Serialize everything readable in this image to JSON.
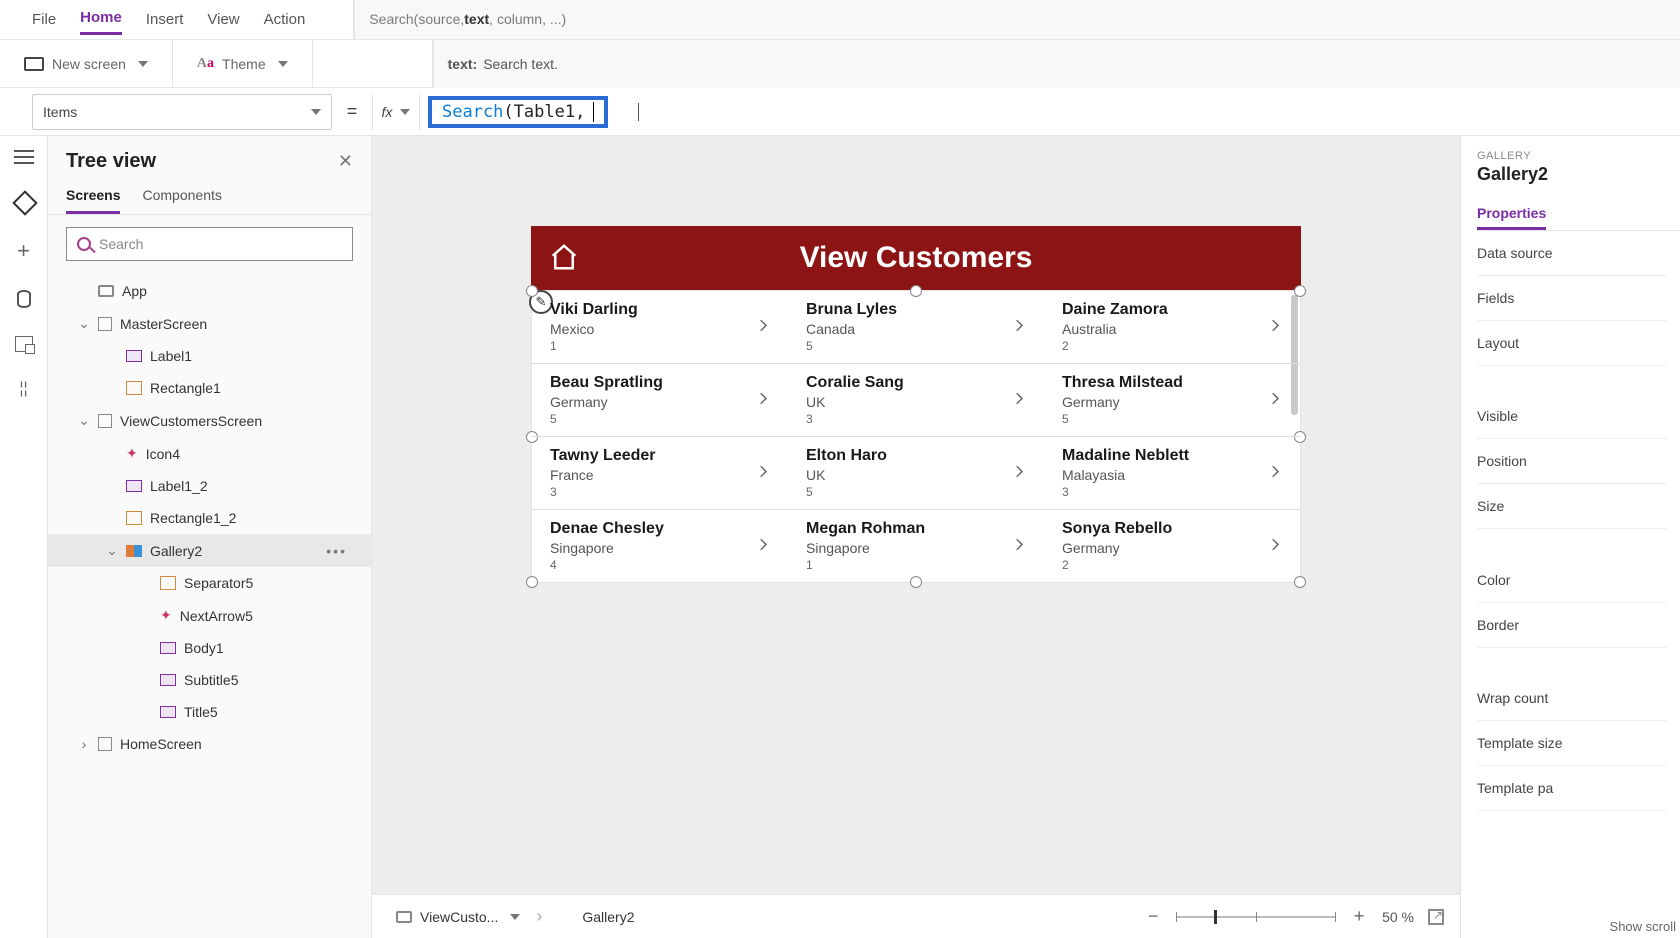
{
  "menu": {
    "tabs": [
      "File",
      "Home",
      "Insert",
      "View",
      "Action"
    ],
    "active": "Home"
  },
  "function_hint": {
    "pre": "Search(source, ",
    "bold": "text",
    "post": ", column, ...)"
  },
  "ribbon": {
    "new_screen": "New screen",
    "theme": "Theme"
  },
  "param_hint": {
    "label": "text:",
    "desc": "Search text."
  },
  "formula": {
    "property": "Items",
    "fx": "fx",
    "func": "Search",
    "rest": "(Table1, "
  },
  "tree": {
    "title": "Tree view",
    "tabs": [
      "Screens",
      "Components"
    ],
    "active_tab": "Screens",
    "search_placeholder": "Search",
    "nodes": [
      {
        "label": "App",
        "type": "app",
        "depth": 1
      },
      {
        "label": "MasterScreen",
        "type": "screen",
        "depth": 1,
        "expanded": true
      },
      {
        "label": "Label1",
        "type": "label",
        "depth": 2
      },
      {
        "label": "Rectangle1",
        "type": "group",
        "depth": 2
      },
      {
        "label": "ViewCustomersScreen",
        "type": "screen",
        "depth": 1,
        "expanded": true
      },
      {
        "label": "Icon4",
        "type": "iconctrl",
        "depth": 2
      },
      {
        "label": "Label1_2",
        "type": "label",
        "depth": 2
      },
      {
        "label": "Rectangle1_2",
        "type": "group",
        "depth": 2
      },
      {
        "label": "Gallery2",
        "type": "gallery",
        "depth": 2,
        "expanded": true,
        "selected": true,
        "menu": true
      },
      {
        "label": "Separator5",
        "type": "group",
        "depth": 3
      },
      {
        "label": "NextArrow5",
        "type": "iconctrl",
        "depth": 3
      },
      {
        "label": "Body1",
        "type": "label",
        "depth": 3
      },
      {
        "label": "Subtitle5",
        "type": "label",
        "depth": 3
      },
      {
        "label": "Title5",
        "type": "label",
        "depth": 3
      },
      {
        "label": "HomeScreen",
        "type": "screen",
        "depth": 1,
        "expanded": false
      }
    ]
  },
  "app_preview": {
    "header": "View Customers",
    "rows": [
      [
        {
          "name": "Viki  Darling",
          "sub": "Mexico",
          "num": "1"
        },
        {
          "name": "Bruna  Lyles",
          "sub": "Canada",
          "num": "5"
        },
        {
          "name": "Daine  Zamora",
          "sub": "Australia",
          "num": "2"
        }
      ],
      [
        {
          "name": "Beau  Spratling",
          "sub": "Germany",
          "num": "5"
        },
        {
          "name": "Coralie  Sang",
          "sub": "UK",
          "num": "3"
        },
        {
          "name": "Thresa  Milstead",
          "sub": "Germany",
          "num": "5"
        }
      ],
      [
        {
          "name": "Tawny  Leeder",
          "sub": "France",
          "num": "3"
        },
        {
          "name": "Elton  Haro",
          "sub": "UK",
          "num": "5"
        },
        {
          "name": "Madaline  Neblett",
          "sub": "Malayasia",
          "num": "3"
        }
      ],
      [
        {
          "name": "Denae  Chesley",
          "sub": "Singapore",
          "num": "4"
        },
        {
          "name": "Megan  Rohman",
          "sub": "Singapore",
          "num": "1"
        },
        {
          "name": "Sonya  Rebello",
          "sub": "Germany",
          "num": "2"
        }
      ]
    ]
  },
  "breadcrumb": {
    "screen": "ViewCusto...",
    "control": "Gallery2",
    "zoom_pct": "50",
    "pct_sign": "%",
    "show_scroll": "Show scroll"
  },
  "props": {
    "caption": "GALLERY",
    "title": "Gallery2",
    "tab": "Properties",
    "items": [
      "Data source",
      "Fields",
      "Layout"
    ],
    "items2": [
      "Visible",
      "Position",
      "Size"
    ],
    "items3": [
      "Color",
      "Border"
    ],
    "items4": [
      "Wrap count",
      "Template size",
      "Template pa"
    ]
  }
}
